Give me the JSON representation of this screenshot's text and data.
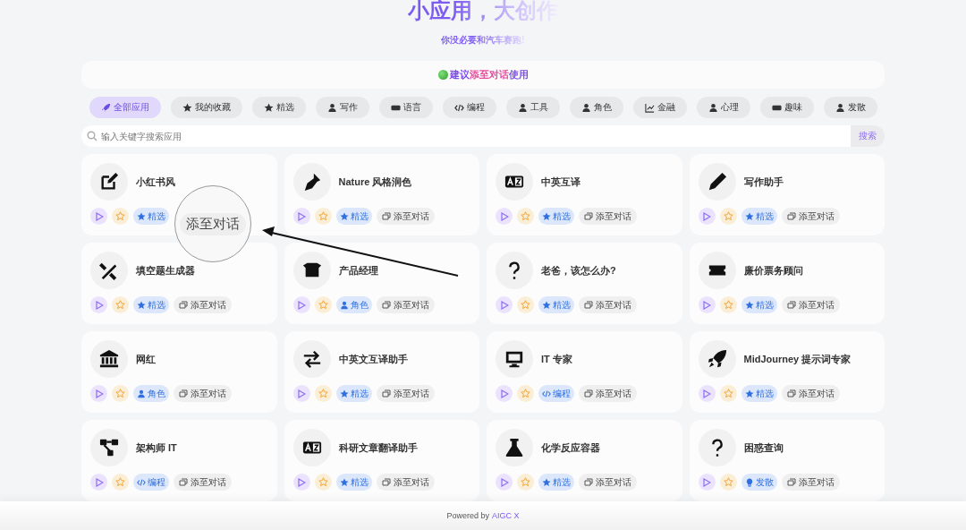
{
  "header": {
    "title": "小应用，大创作",
    "subtitle": "你没必要和汽车赛跑!"
  },
  "notice": {
    "prefix": "建议",
    "highlight": "添至对话",
    "suffix": "使用"
  },
  "categories": [
    {
      "label": "全部应用",
      "selected": true
    },
    {
      "label": "我的收藏",
      "selected": false
    },
    {
      "label": "精选",
      "selected": false
    },
    {
      "label": "写作",
      "selected": false
    },
    {
      "label": "语言",
      "selected": false
    },
    {
      "label": "编程",
      "selected": false
    },
    {
      "label": "工具",
      "selected": false
    },
    {
      "label": "角色",
      "selected": false
    },
    {
      "label": "金融",
      "selected": false
    },
    {
      "label": "心理",
      "selected": false
    },
    {
      "label": "趣味",
      "selected": false
    },
    {
      "label": "发散",
      "selected": false
    }
  ],
  "search": {
    "placeholder": "输入关键字搜索应用",
    "button": "搜索"
  },
  "cards": [
    {
      "title": "小红书风",
      "tag": {
        "kind": "featured",
        "label": "精选"
      }
    },
    {
      "title": "Nature 风格润色",
      "tag": {
        "kind": "featured",
        "label": "精选"
      },
      "add_label": "添至对话"
    },
    {
      "title": "中英互译",
      "tag": {
        "kind": "featured",
        "label": "精选"
      },
      "add_label": "添至对话"
    },
    {
      "title": "写作助手",
      "tag": {
        "kind": "featured",
        "label": "精选"
      },
      "add_label": "添至对话"
    },
    {
      "title": "填空题生成器",
      "tag": {
        "kind": "featured",
        "label": "精选"
      },
      "add_label": "添至对话"
    },
    {
      "title": "产品经理",
      "tag": {
        "kind": "role",
        "label": "角色"
      },
      "add_label": "添至对话"
    },
    {
      "title": "老爸，该怎么办?",
      "tag": {
        "kind": "featured",
        "label": "精选"
      },
      "add_label": "添至对话"
    },
    {
      "title": "廉价票务顾问",
      "tag": {
        "kind": "featured",
        "label": "精选"
      },
      "add_label": "添至对话"
    },
    {
      "title": "网红",
      "tag": {
        "kind": "role",
        "label": "角色"
      },
      "add_label": "添至对话"
    },
    {
      "title": "中英文互译助手",
      "tag": {
        "kind": "featured",
        "label": "精选"
      },
      "add_label": "添至对话"
    },
    {
      "title": "IT 专家",
      "tag": {
        "kind": "code",
        "label": "编程"
      },
      "add_label": "添至对话"
    },
    {
      "title": "MidJourney 提示词专家",
      "tag": {
        "kind": "featured",
        "label": "精选"
      },
      "add_label": "添至对话"
    },
    {
      "title": "架构师 IT",
      "tag": {
        "kind": "code",
        "label": "编程"
      },
      "add_label": "添至对话"
    },
    {
      "title": "科研文章翻译助手",
      "tag": {
        "kind": "featured",
        "label": "精选"
      },
      "add_label": "添至对话"
    },
    {
      "title": "化学反应容器",
      "tag": {
        "kind": "featured",
        "label": "精选"
      },
      "add_label": "添至对话"
    },
    {
      "title": "困惑查询",
      "tag": {
        "kind": "idea",
        "label": "发散"
      },
      "add_label": "添至对话"
    }
  ],
  "magnifier": {
    "label": "添至对话"
  },
  "footer": {
    "prefix": "Powered by",
    "link": "AIGC X"
  }
}
